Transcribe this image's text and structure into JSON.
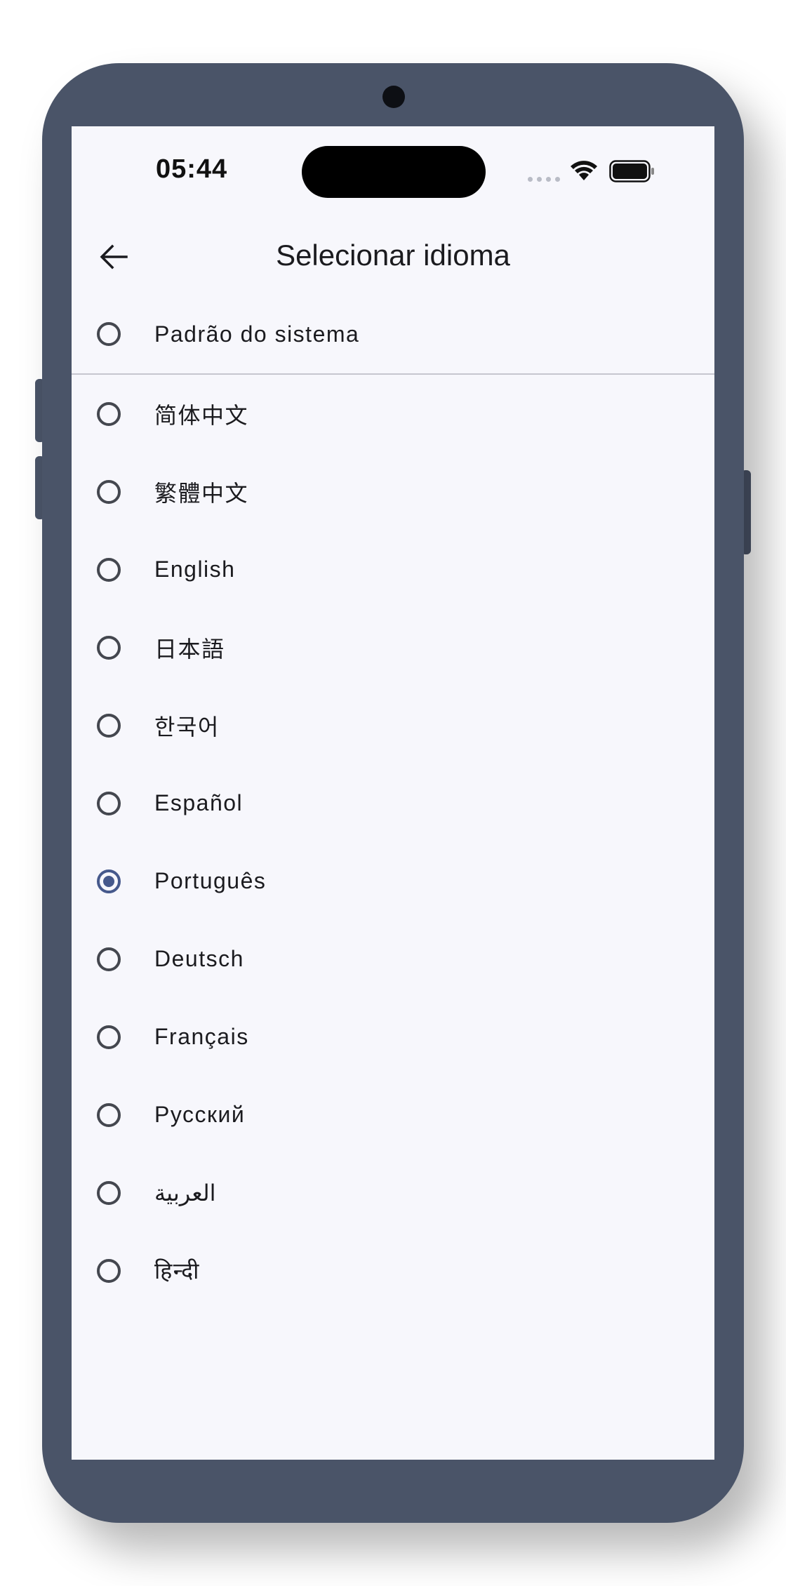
{
  "status_bar": {
    "time": "05:44"
  },
  "app_bar": {
    "title": "Selecionar idioma",
    "back_icon": "arrow-left-icon"
  },
  "colors": {
    "frame": "#4a5468",
    "screen_bg": "#f7f7fc",
    "accent": "#46598c"
  },
  "system_option": {
    "label": "Padrão do sistema",
    "selected": false
  },
  "languages": [
    {
      "label": "简体中文",
      "selected": false
    },
    {
      "label": "繁體中文",
      "selected": false
    },
    {
      "label": "English",
      "selected": false
    },
    {
      "label": "日本語",
      "selected": false
    },
    {
      "label": "한국어",
      "selected": false
    },
    {
      "label": "Español",
      "selected": false
    },
    {
      "label": "Português",
      "selected": true
    },
    {
      "label": "Deutsch",
      "selected": false
    },
    {
      "label": "Français",
      "selected": false
    },
    {
      "label": "Русский",
      "selected": false
    },
    {
      "label": "العربية",
      "selected": false
    },
    {
      "label": "हिन्दी",
      "selected": false
    }
  ]
}
